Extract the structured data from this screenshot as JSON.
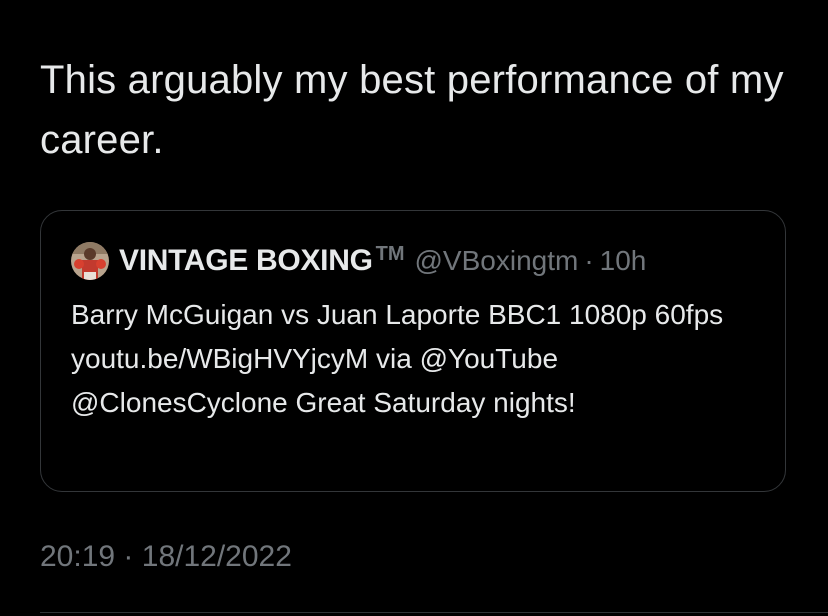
{
  "tweet": {
    "text": "This arguably my best performance of my career.",
    "time": "20:19",
    "separator": "·",
    "date": "18/12/2022"
  },
  "quoted_tweet": {
    "avatar_icon": "boxer-avatar-icon",
    "display_name": "VINTAGE BOXING",
    "trademark": "TM",
    "handle": "@VBoxingtm",
    "separator": "·",
    "age": "10h",
    "text": "Barry McGuigan vs Juan Laporte BBC1 1080p 60fps youtu.be/WBigHVYjcyM via @YouTube @ClonesCyclone Great Saturday nights!"
  },
  "colors": {
    "background": "#000000",
    "primary_text": "#e7e9ea",
    "secondary_text": "#71767b",
    "border": "#333639"
  }
}
